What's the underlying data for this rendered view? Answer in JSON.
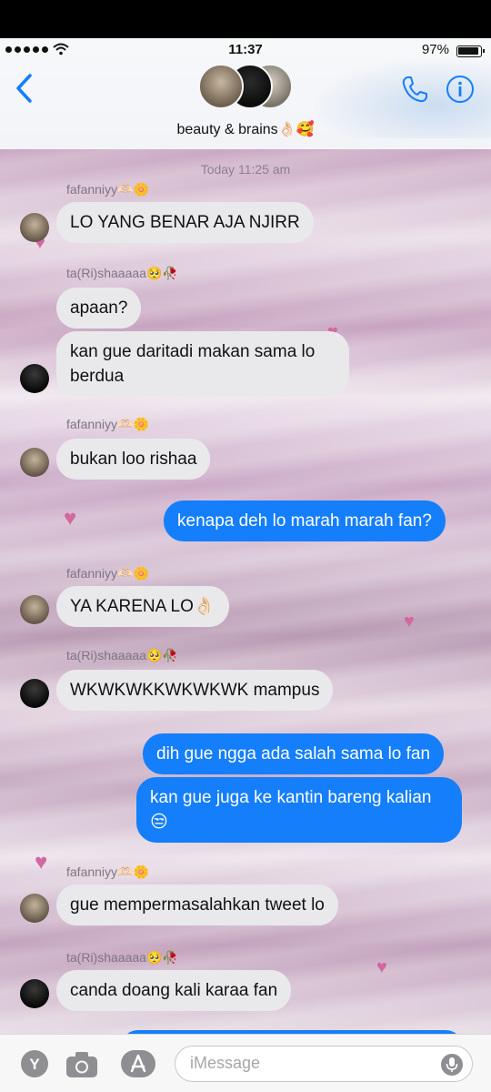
{
  "status": {
    "time": "11:37",
    "battery": "97%"
  },
  "header": {
    "group_name": "beauty & brains👌🏻🥰"
  },
  "chat": {
    "timestamp": "Today 11:25 am",
    "messages": [
      {
        "sender": "fafanniyy🫶🏻🌼",
        "text": "LO YANG BENAR AJA NJIRR"
      },
      {
        "sender": "ta(Ri)shaaaaa🥺🥀",
        "text": "apaan?"
      },
      {
        "text": "kan gue daritadi makan sama lo berdua"
      },
      {
        "sender": "fafanniyy🫶🏻🌼",
        "text": "bukan loo rishaa"
      },
      {
        "text": "kenapa deh lo marah marah fan?"
      },
      {
        "sender": "fafanniyy🫶🏻🌼",
        "text": "YA KARENA LO👌🏻"
      },
      {
        "sender": "ta(Ri)shaaaaa🥺🥀",
        "text": "WKWKWKKWKWKWK mampus"
      },
      {
        "text": "dih gue ngga ada salah sama lo fan"
      },
      {
        "text": "kan gue juga ke kantin bareng kalian 😒"
      },
      {
        "sender": "fafanniyy🫶🏻🌼",
        "text": "gue mempermasalahkan tweet lo"
      },
      {
        "sender": "ta(Ri)shaaaaa🥺🥀",
        "text": "canda doang kali karaa fan"
      }
    ]
  },
  "compose": {
    "placeholder": "iMessage"
  },
  "colors": {
    "accent": "#147efb",
    "incoming_bubble": "#e9e9eb"
  },
  "icons": [
    "back-icon",
    "phone-icon",
    "info-icon",
    "app-store-y-icon",
    "camera-icon",
    "apps-icon",
    "microphone-icon",
    "heart-icon"
  ]
}
